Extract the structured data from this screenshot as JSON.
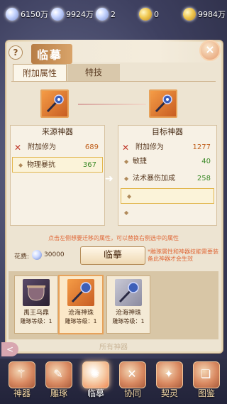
{
  "currencies": [
    {
      "icon": "diamond-icon",
      "value": "6150万"
    },
    {
      "icon": "diamond-icon",
      "value": "9924万"
    },
    {
      "icon": "ticket-icon",
      "value": "2"
    },
    {
      "icon": "gold-ingot-icon",
      "value": "0"
    },
    {
      "icon": "gold-ingot-icon",
      "value": "9984万"
    }
  ],
  "header": {
    "title": "临摹",
    "help": "?",
    "close": "×"
  },
  "tabs": [
    {
      "label": "附加属性"
    },
    {
      "label": "特技"
    }
  ],
  "source": {
    "title": "来源神器",
    "rows": [
      {
        "name": "附加修为",
        "value": "689"
      },
      {
        "name": "物理暴抗",
        "value": "367"
      }
    ]
  },
  "target": {
    "title": "目标神器",
    "rows": [
      {
        "name": "附加修为",
        "value": "1277"
      },
      {
        "name": "敏捷",
        "value": "40"
      },
      {
        "name": "法术暴伤加成",
        "value": "258"
      }
    ]
  },
  "hint": "点击左侧想要迁移的属性，可以替换右侧选中的属性",
  "fee": {
    "label": "花费:",
    "value": "30000"
  },
  "action_button": "临摹",
  "note": "*雕琢属性和神器技能需要装备此神器才会生效",
  "artifacts": [
    {
      "name": "禹王乌鼎",
      "level": "雕琢等级：1"
    },
    {
      "name": "沧海神珠",
      "level": "雕琢等级：1"
    },
    {
      "name": "沧海神珠",
      "level": "雕琢等级：1"
    }
  ],
  "all_label": "所有神器",
  "nav": [
    {
      "label": "神器",
      "icon": "artifact-icon"
    },
    {
      "label": "雕琢",
      "icon": "carve-icon"
    },
    {
      "label": "临摹",
      "icon": "copy-icon"
    },
    {
      "label": "协同",
      "icon": "synergy-icon"
    },
    {
      "label": "契灵",
      "icon": "spirit-icon"
    },
    {
      "label": "图鉴",
      "icon": "book-icon"
    }
  ],
  "colors": {
    "accent": "#e7a25a",
    "value_green": "#3c8a28",
    "value_orange": "#c0601d",
    "hint_red": "#e06a3a"
  }
}
